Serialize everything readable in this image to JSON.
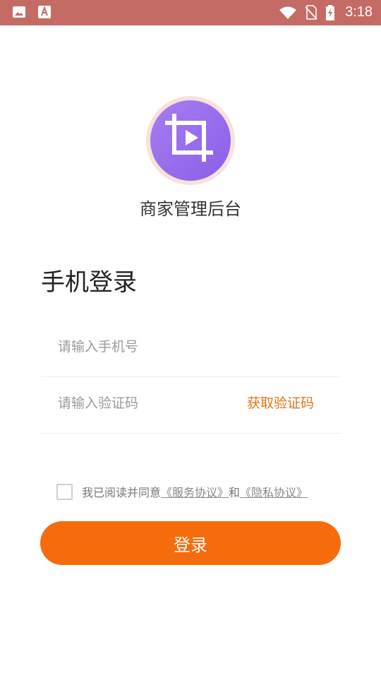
{
  "status_bar": {
    "time": "3:18",
    "icons": [
      "gallery-icon",
      "font-app-icon",
      "wifi-icon",
      "no-sim-icon",
      "battery-charging-icon"
    ]
  },
  "app": {
    "name": "商家管理后台",
    "logo_icon": "video-crop-icon"
  },
  "login": {
    "heading": "手机登录",
    "phone_placeholder": "请输入手机号",
    "code_placeholder": "请输入验证码",
    "get_code_label": "获取验证码",
    "agree_text": "我已阅读并同意",
    "service_link": "《服务协议》",
    "and_text": "和",
    "privacy_link": "《隐私协议》",
    "button_label": "登录"
  },
  "colors": {
    "status_bar": "#c46b65",
    "accent": "#f66c0c",
    "logo_purple": "#8a5fe8",
    "link_orange": "#e67416"
  }
}
